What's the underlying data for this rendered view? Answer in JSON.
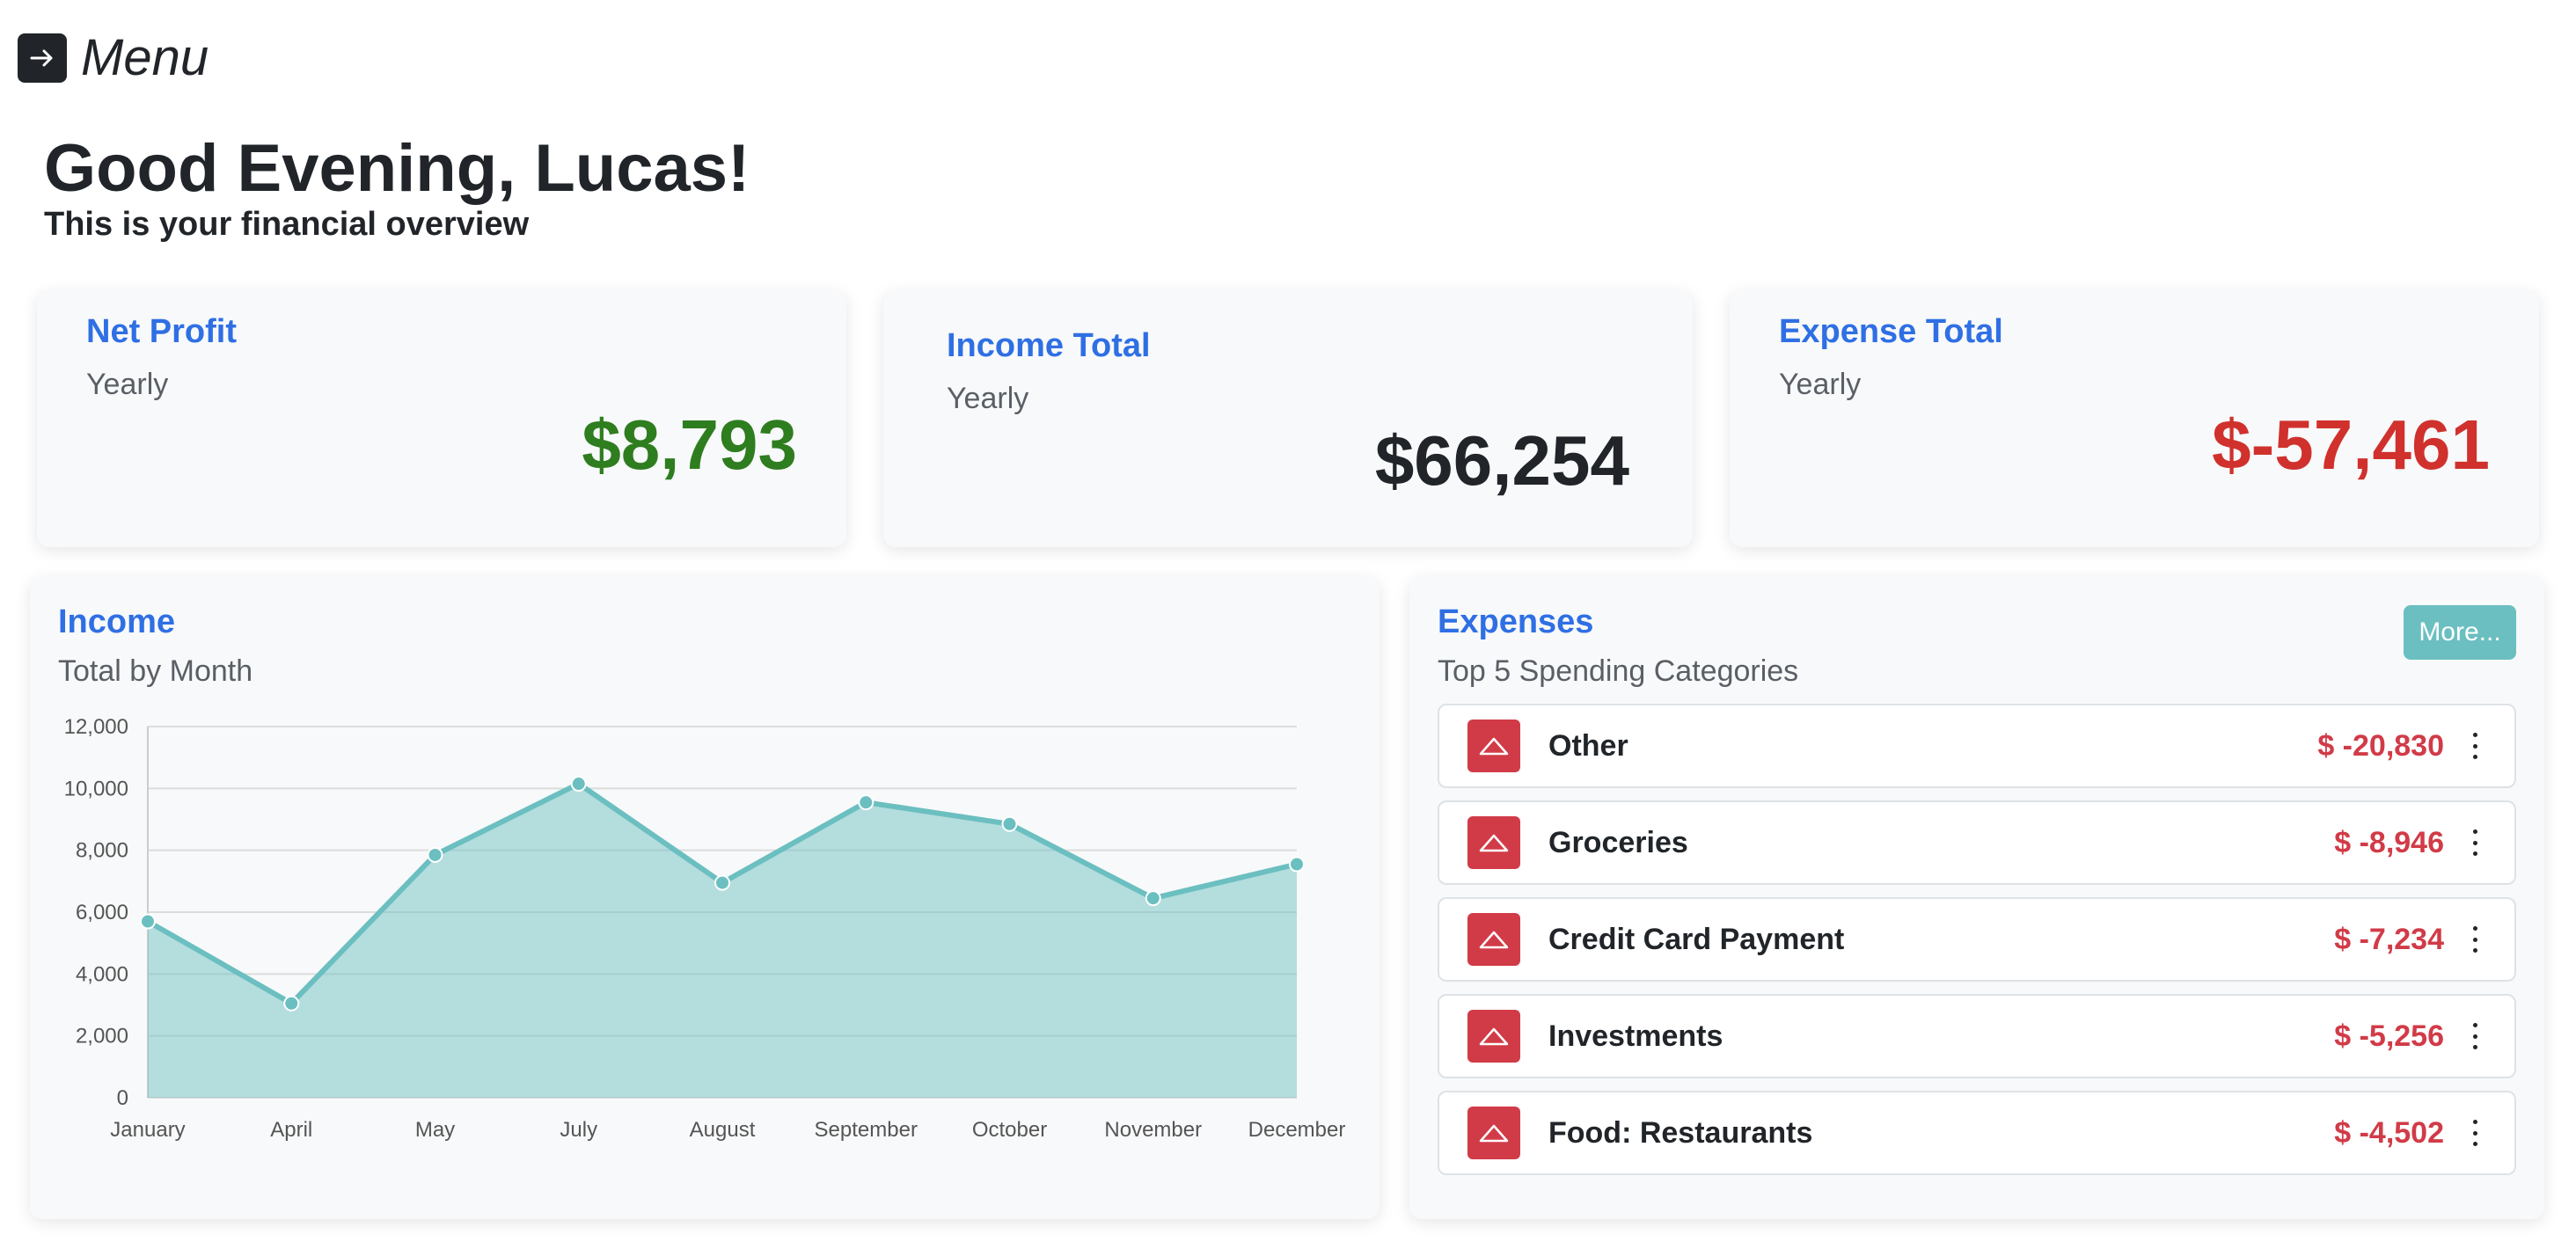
{
  "menu": {
    "label": "Menu",
    "icon": "arrow-right-icon"
  },
  "header": {
    "greeting": "Good Evening, Lucas!",
    "subtitle": "This is your financial overview"
  },
  "summary_cards": {
    "net_profit": {
      "title": "Net Profit",
      "period": "Yearly",
      "value": "$8,793",
      "color": "#2e7d1f"
    },
    "income_total": {
      "title": "Income Total",
      "period": "Yearly",
      "value": "$66,254",
      "color": "#212529"
    },
    "expense_total": {
      "title": "Expense Total",
      "period": "Yearly",
      "value": "$-57,461",
      "color": "#d0312d"
    }
  },
  "income_panel": {
    "title": "Income",
    "subtitle": "Total by Month"
  },
  "expenses_panel": {
    "title": "Expenses",
    "subtitle": "Top 5 Spending Categories",
    "more_label": "More...",
    "items": [
      {
        "name": "Other",
        "amount": "$ -20,830"
      },
      {
        "name": "Groceries",
        "amount": "$ -8,946"
      },
      {
        "name": "Credit Card Payment",
        "amount": "$ -7,234"
      },
      {
        "name": "Investments",
        "amount": "$ -5,256"
      },
      {
        "name": "Food: Restaurants",
        "amount": "$ -4,502"
      }
    ]
  },
  "colors": {
    "accent": "#2f6fe4",
    "teal": "#6bbfc0",
    "negative": "#d13b47"
  },
  "chart_data": {
    "type": "area",
    "categories": [
      "January",
      "April",
      "May",
      "July",
      "August",
      "September",
      "October",
      "November",
      "December"
    ],
    "values": [
      5700,
      3050,
      7850,
      10150,
      6950,
      9550,
      8850,
      6450,
      7550
    ],
    "ylim": [
      0,
      12000
    ],
    "yticks": [
      "0",
      "2,000",
      "4,000",
      "6,000",
      "8,000",
      "10,000",
      "12,000"
    ],
    "grid": true,
    "title": "",
    "xlabel": "",
    "ylabel": ""
  }
}
